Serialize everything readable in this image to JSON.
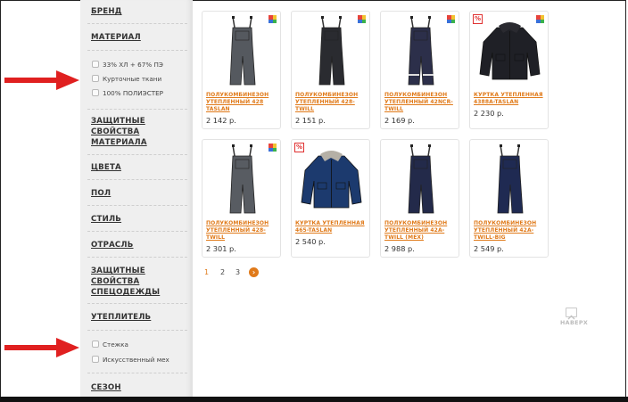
{
  "sidebar": {
    "sections": {
      "brand": "БРЕНД",
      "material": "МАТЕРИАЛ",
      "protective_material_l1": "ЗАЩИТНЫЕ",
      "protective_material_l2": "СВОЙСТВА",
      "protective_material_l3": "МАТЕРИАЛА",
      "colors": "ЦВЕТА",
      "gender": "ПОЛ",
      "style": "СТИЛЬ",
      "industry": "ОТРАСЛЬ",
      "protective_workwear_l1": "ЗАЩИТНЫЕ",
      "protective_workwear_l2": "СВОЙСТВА",
      "protective_workwear_l3": "СПЕЦОДЕЖДЫ",
      "insulation": "УТЕПЛИТЕЛЬ",
      "season": "СЕЗОН"
    },
    "material_options": [
      "33% ХЛ + 67% ПЭ",
      "Курточные ткани",
      "100% ПОЛИЭСТЕР"
    ],
    "insulation_options": [
      "Стежка",
      "Искусственный мех"
    ]
  },
  "products": [
    {
      "title_l1": "ПОЛУКОМБИНЕЗОН",
      "title_l2": "УТЕПЛЕННЫЙ 428",
      "title_l3": "TASLAN",
      "price": "2 142 р.",
      "badge": "colors",
      "image": "overalls-icon"
    },
    {
      "title_l1": "ПОЛУКОМБИНЕЗОН",
      "title_l2": "УТЕПЛЕННЫЙ 428-",
      "title_l3": "TWILL",
      "price": "2 151 р.",
      "badge": "colors",
      "image": "overalls-icon"
    },
    {
      "title_l1": "ПОЛУКОМБИНЕЗОН",
      "title_l2": "УТЕПЛЕННЫЙ 42NCR-",
      "title_l3": "TWILL",
      "price": "2 169 р.",
      "badge": "colors",
      "image": "overalls-icon"
    },
    {
      "title_l1": "КУРТКА УТЕПЛЕННАЯ",
      "title_l2": "4388A-TASLAN",
      "title_l3": "",
      "price": "2 230 р.",
      "badge": "both",
      "image": "jacket-icon"
    },
    {
      "title_l1": "ПОЛУКОМБИНЕЗОН",
      "title_l2": "УТЕПЛЕННЫЙ 428-",
      "title_l3": "TWILL",
      "price": "2 301 р.",
      "badge": "colors",
      "image": "overalls-icon"
    },
    {
      "title_l1": "КУРТКА УТЕПЛЕННАЯ",
      "title_l2": "465-TASLAN",
      "title_l3": "",
      "price": "2 540 р.",
      "badge": "percent",
      "image": "jacket-icon"
    },
    {
      "title_l1": "ПОЛУКОМБИНЕЗОН",
      "title_l2": "УТЕПЛЕННЫЙ 42A-",
      "title_l3": "TWILL (MEX)",
      "price": "2 988 р.",
      "badge": "none",
      "image": "overalls-icon"
    },
    {
      "title_l1": "ПОЛУКОМБИНЕЗОН",
      "title_l2": "УТЕПЛЕННЫЙ 42A-",
      "title_l3": "TWILL-BIG",
      "price": "2 549 р.",
      "badge": "none",
      "image": "overalls-icon"
    }
  ],
  "pagination": {
    "pages": [
      "1",
      "2",
      "3"
    ],
    "current": "1",
    "next_icon": "next-arrow-icon"
  },
  "scroll_up": {
    "label": "НАВЕРХ"
  },
  "colors": {
    "accent": "#e07a1a",
    "arrow": "#e02020",
    "sale_badge": "#e03030"
  }
}
